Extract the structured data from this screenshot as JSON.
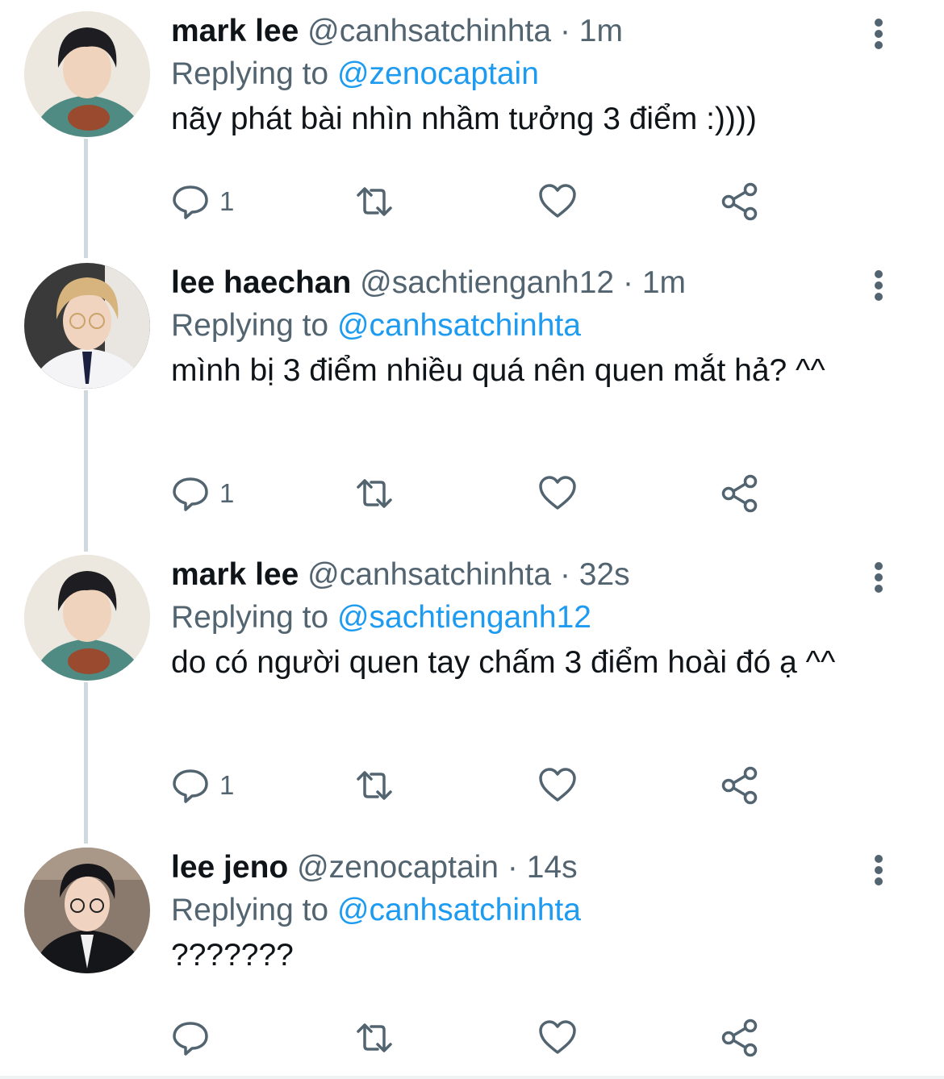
{
  "replying_label": "Replying to",
  "tweets": [
    {
      "name": "mark lee",
      "handle": "@canhsatchinhta",
      "time": "1m",
      "reply_to": "@zenocaptain",
      "text": "nãy phát bài nhìn nhầm tưởng 3 điểm :))))",
      "reply_count": "1"
    },
    {
      "name": "lee haechan",
      "handle": "@sachtienganh12",
      "time": "1m",
      "reply_to": "@canhsatchinhta",
      "text": "mình bị 3 điểm nhiều quá nên quen mắt hả? ^^",
      "reply_count": "1"
    },
    {
      "name": "mark lee",
      "handle": "@canhsatchinhta",
      "time": "32s",
      "reply_to": "@sachtienganh12",
      "text": "do có người quen tay chấm 3 điểm hoài đó ạ ^^",
      "reply_count": "1"
    },
    {
      "name": "lee jeno",
      "handle": "@zenocaptain",
      "time": "14s",
      "reply_to": "@canhsatchinhta",
      "text": "???????",
      "reply_count": ""
    }
  ],
  "icons": {
    "reply": "reply-icon",
    "retweet": "retweet-icon",
    "like": "heart-icon",
    "share": "share-icon",
    "more": "more-vertical-icon"
  },
  "colors": {
    "name": "#0f1419",
    "secondary": "#536471",
    "link": "#1d9bf0",
    "thread_line": "#cfd9de"
  }
}
